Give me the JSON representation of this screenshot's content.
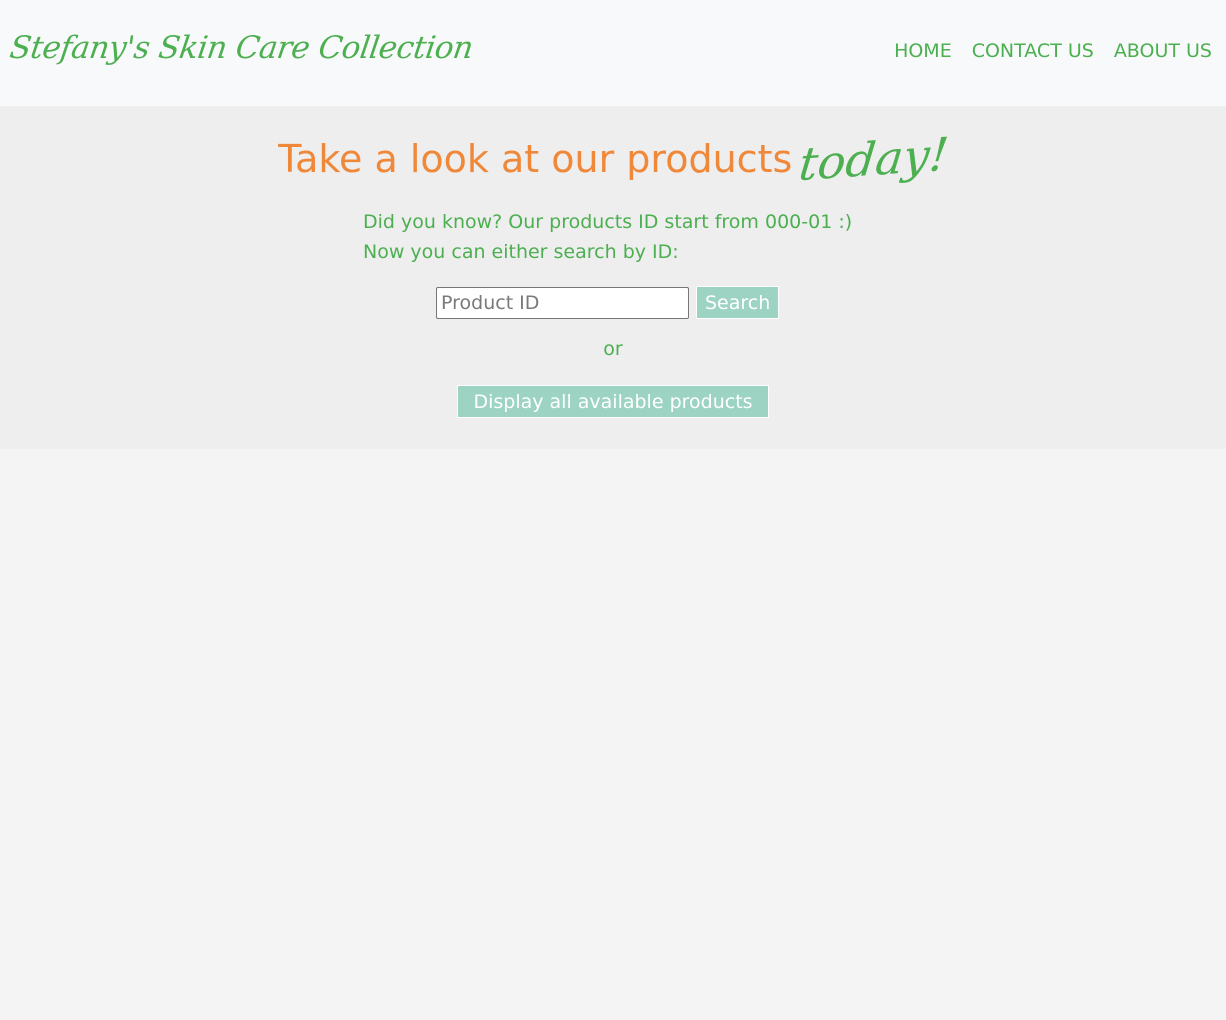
{
  "header": {
    "brand": "Stefany's Skin Care Collection",
    "nav": [
      {
        "label": "HOME"
      },
      {
        "label": "CONTACT US"
      },
      {
        "label": "ABOUT US"
      }
    ]
  },
  "hero": {
    "title_main": "Take a look at our products",
    "title_accent": "today!",
    "info_line1": "Did you know? Our products ID start from 000-01 :)",
    "info_line2": "Now you can either search by ID:",
    "search_placeholder": "Product ID",
    "search_value": "",
    "search_button": "Search",
    "or_text": "or",
    "display_all_button": "Display all available products"
  },
  "colors": {
    "green": "#4caf50",
    "orange": "#f0883a",
    "button_teal": "#9dd3c2",
    "header_bg": "#f8f9fa",
    "hero_bg": "#eeeeee",
    "page_bg": "#f4f4f4"
  }
}
